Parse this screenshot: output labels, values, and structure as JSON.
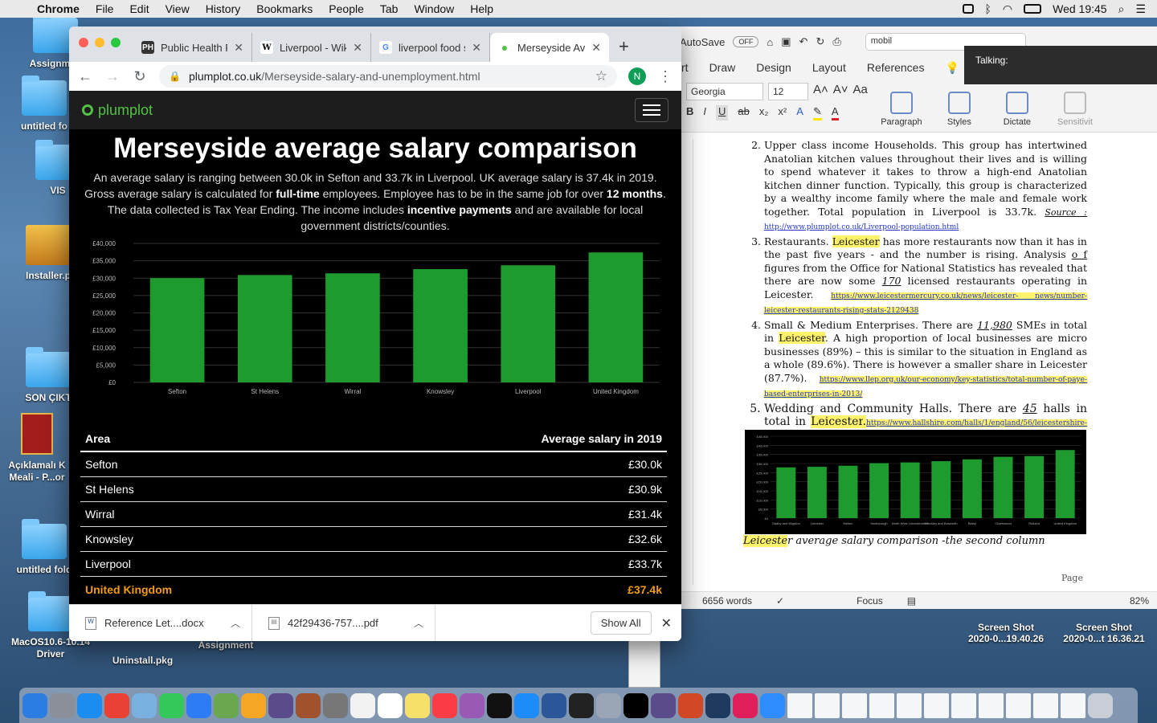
{
  "menubar": {
    "app": "Chrome",
    "menus": [
      "File",
      "Edit",
      "View",
      "History",
      "Bookmarks",
      "People",
      "Tab",
      "Window",
      "Help"
    ],
    "clock": "Wed 19:45"
  },
  "desktop": {
    "icons": [
      "Assignmen",
      "untitled fo",
      "VIS",
      "Installer.p",
      "SON ÇIKT",
      "Açıklamalı K\nMeali - P...or",
      "untitled fold",
      "MacOS10.6-10.14\nDriver",
      "Uninstall.pkg",
      "Assignment"
    ],
    "screenshots": [
      "Screen Shot\n2020-0...19.40.26",
      "Screen Shot\n2020-0...t 16.36.21"
    ]
  },
  "chrome": {
    "tabs": [
      {
        "title": "Public Health P",
        "favicon": "PH"
      },
      {
        "title": "Liverpool - Wik",
        "favicon": "W"
      },
      {
        "title": "liverpool food s",
        "favicon": "G"
      },
      {
        "title": "Merseyside Av",
        "favicon": "●"
      }
    ],
    "url_domain": "plumplot.co.uk",
    "url_path": "/Merseyside-salary-and-unemployment.html",
    "profile_initial": "N"
  },
  "site": {
    "logo": "plumplot",
    "title": "Merseyside average salary comparison",
    "intro_1": "An average salary is ranging between 30.0k in Sefton and 33.7k in Liverpool. UK average salary is 37.4k in 2019. Gross average salary is calculated for ",
    "intro_b1": "full-time",
    "intro_2": " employees. Employee has to be in the same job for over ",
    "intro_b2": "12 months",
    "intro_3": ". The data collected is Tax Year Ending. The income includes ",
    "intro_b3": "incentive payments",
    "intro_4": " and are available for local government districts/counties.",
    "table": {
      "col1": "Area",
      "col2": "Average salary in 2019",
      "rows": [
        {
          "area": "Sefton",
          "value": "£30.0k"
        },
        {
          "area": "St Helens",
          "value": "£30.9k"
        },
        {
          "area": "Wirral",
          "value": "£31.4k"
        },
        {
          "area": "Knowsley",
          "value": "£32.6k"
        },
        {
          "area": "Liverpool",
          "value": "£33.7k"
        },
        {
          "area": "United Kingdom",
          "value": "£37.4k"
        }
      ]
    }
  },
  "chart_data": {
    "type": "bar",
    "categories": [
      "Sefton",
      "St Helens",
      "Wirral",
      "Knowsley",
      "Liverpool",
      "United Kingdom"
    ],
    "values": [
      30000,
      30900,
      31400,
      32600,
      33700,
      37400
    ],
    "ylim": [
      0,
      40000
    ],
    "yticks": [
      "£0",
      "£5,000",
      "£10,000",
      "£15,000",
      "£20,000",
      "£25,000",
      "£30,000",
      "£35,000",
      "£40,000"
    ],
    "bar_color": "#1f9a2e",
    "grid": true
  },
  "downloads": {
    "items": [
      "Reference Let....docx",
      "42f29436-757....pdf"
    ],
    "show_all": "Show All"
  },
  "word": {
    "autosave": "AutoSave",
    "autosave_state": "OFF",
    "search": "mobil",
    "talking": "Talking:",
    "tabs": [
      "rt",
      "Draw",
      "Design",
      "Layout",
      "References"
    ],
    "font": "Georgia",
    "size": "12",
    "groups": [
      "Paragraph",
      "Styles",
      "Dictate",
      "Sensitivit"
    ],
    "item2": "Upper class income Households. This group has intertwined Anatolian kitchen values throughout their lives and is willing to spend whatever it takes to throw a high-end Anatolian kitchen dinner function. Typically, this group is characterized by a wealthy income family where the male and female work together. Total population in Liverpool is 33.7k. ",
    "item2_source": "Source :",
    "item2_link": "http://www.plumplot.co.uk/Liverpool-population.html",
    "item3_a": "Restaurants. ",
    "leicester": "Leicester",
    "item3_b": " has more restaurants now than it has in the past five years - and the number is rising. Analysis ",
    "item3_of": "o f",
    "item3_c": " figures from the Office for National Statistics has revealed that there are now some ",
    "item3_170": "170",
    "item3_d": " licensed restaurants operating in Leicester. ",
    "item3_link": "https://www.leicestermercury.co.uk/news/leicester- news/number-leicester-restaurants-rising-stats-2129438",
    "item4_a": "Small & Medium Enterprises. There are ",
    "item4_n": "11,980",
    "item4_b": " SMEs in total in ",
    "item4_c": ". A high proportion of local businesses are micro businesses (89%) – this is similar to the situation in England as a whole (89.6%). There is however a smaller share in Leicester (87.7%). ",
    "item4_link": "https://www.llep.org.uk/our-economy/key-statistics/total-number-of-paye-based-enterprises-in-2013/",
    "item5_a": "Wedding and Community Halls. There are ",
    "item5_n": "45",
    "item5_b": " halls in total in ",
    "item5_link": "https://www.hallshire.com/halls/1/england/56/leicestershire-halls-for-hire",
    "caption_hl": "Leiceste",
    "caption_rest": "r average salary comparison -the second column",
    "page_label": "Page",
    "words": "6656 words",
    "focus": "Focus",
    "zoom": "82%",
    "mini_chart": {
      "categories": [
        "Oadby and Wigston",
        "Leicester",
        "Melton",
        "Harborough",
        "North West Leicestershire",
        "Hinckley and Bosworth",
        "Blaby",
        "Charnwood",
        "Rutland",
        "United Kingdom"
      ],
      "values": [
        27900,
        28200,
        28800,
        30200,
        30600,
        31300,
        32300,
        33700,
        34100,
        37400
      ],
      "yticks": [
        "£0",
        "£5,000",
        "£10,000",
        "£15,000",
        "£20,000",
        "£25,000",
        "£30,000",
        "£35,000",
        "£40,000",
        "£45,000"
      ]
    }
  }
}
